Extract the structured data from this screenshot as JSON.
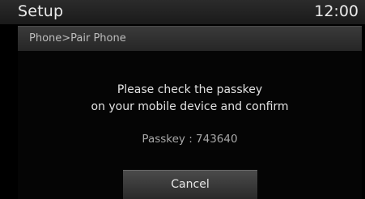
{
  "header": {
    "title": "Setup",
    "time": "12:00"
  },
  "breadcrumb": "Phone>Pair Phone",
  "dialog": {
    "message_line1": "Please check the passkey",
    "message_line2": "on your mobile device and confirm",
    "passkey_text": "Passkey : 743640",
    "cancel_label": "Cancel"
  }
}
